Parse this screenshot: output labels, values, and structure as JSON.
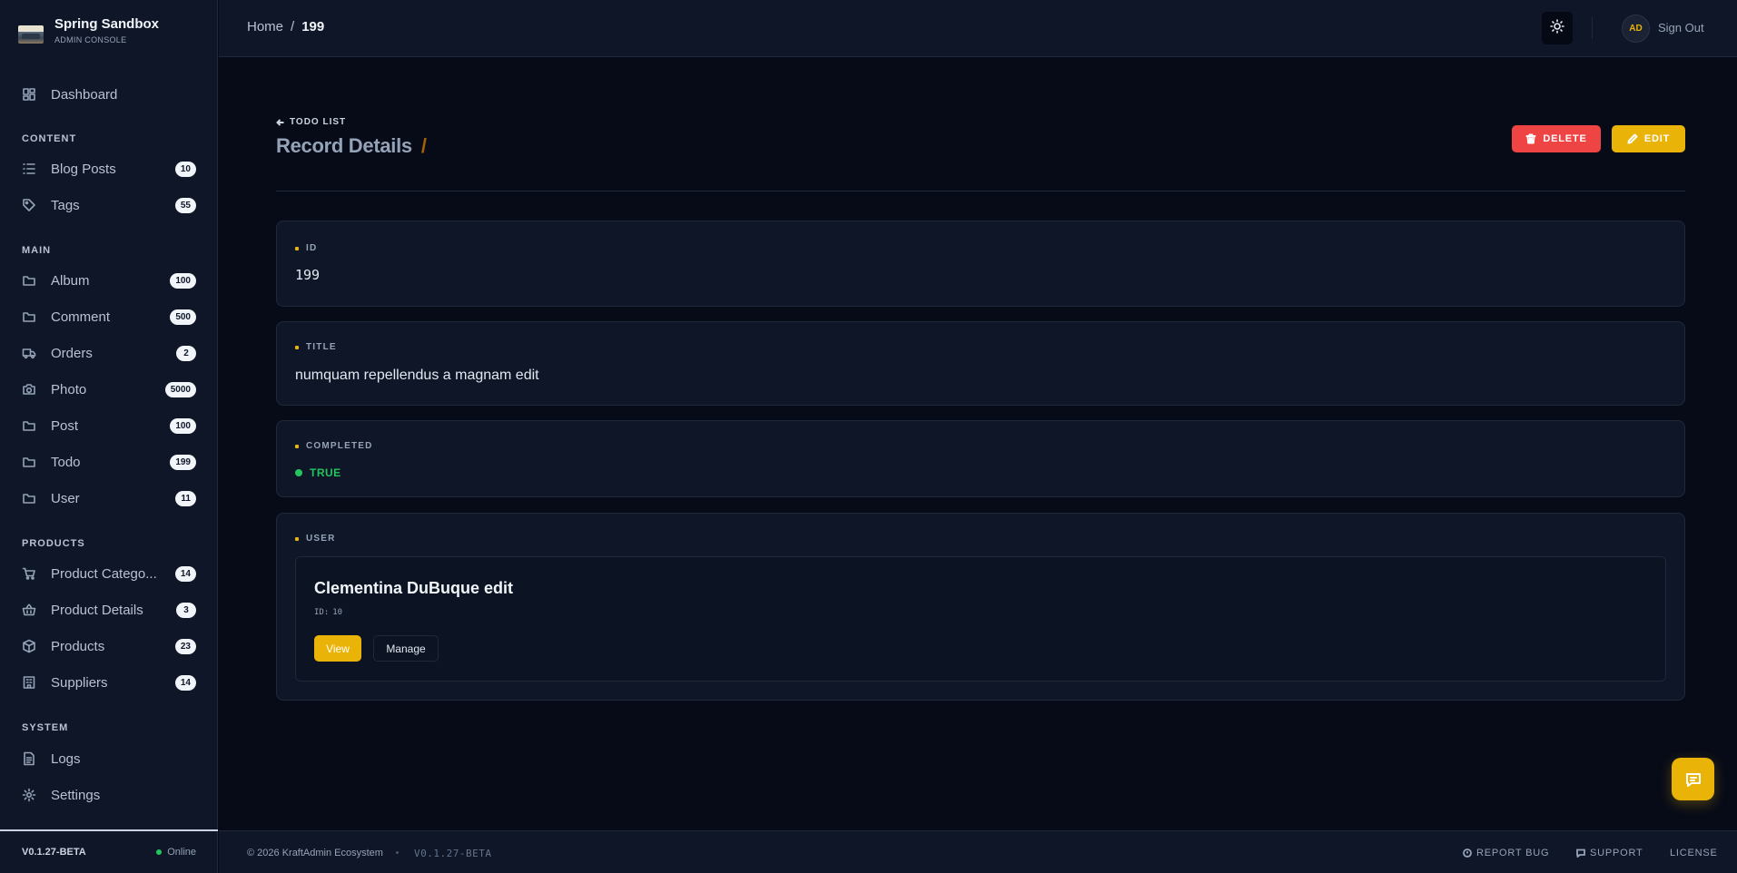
{
  "brand": {
    "title": "Spring Sandbox",
    "subtitle": "ADMIN CONSOLE"
  },
  "sidebar": {
    "dashboard": {
      "label": "Dashboard",
      "icon": "dashboard-icon"
    },
    "sections": {
      "content": "CONTENT",
      "main": "MAIN",
      "products": "PRODUCTS",
      "system": "SYSTEM"
    },
    "content_items": [
      {
        "label": "Blog Posts",
        "count": "10",
        "icon": "list-icon"
      },
      {
        "label": "Tags",
        "count": "55",
        "icon": "tag-icon"
      }
    ],
    "main_items": [
      {
        "label": "Album",
        "count": "100",
        "icon": "folder-icon"
      },
      {
        "label": "Comment",
        "count": "500",
        "icon": "folder-icon"
      },
      {
        "label": "Orders",
        "count": "2",
        "icon": "truck-icon"
      },
      {
        "label": "Photo",
        "count": "5000",
        "icon": "camera-icon"
      },
      {
        "label": "Post",
        "count": "100",
        "icon": "folder-icon"
      },
      {
        "label": "Todo",
        "count": "199",
        "icon": "folder-icon"
      },
      {
        "label": "User",
        "count": "11",
        "icon": "folder-icon"
      }
    ],
    "product_items": [
      {
        "label": "Product Catego...",
        "count": "14",
        "icon": "cart-icon"
      },
      {
        "label": "Product Details",
        "count": "3",
        "icon": "basket-icon"
      },
      {
        "label": "Products",
        "count": "23",
        "icon": "box-icon"
      },
      {
        "label": "Suppliers",
        "count": "14",
        "icon": "building-icon"
      }
    ],
    "system_items": [
      {
        "label": "Logs",
        "icon": "file-icon"
      },
      {
        "label": "Settings",
        "icon": "gear-icon"
      }
    ],
    "footer": {
      "version": "V0.1.27-BETA",
      "status": "Online"
    }
  },
  "topbar": {
    "breadcrumb": {
      "home": "Home",
      "separator": "/",
      "current": "199"
    },
    "avatar_initials": "AD",
    "sign_out": "Sign Out"
  },
  "page": {
    "back_label": "TODO LIST",
    "title": "Record Details",
    "title_suffix": "/",
    "delete_label": "DELETE",
    "edit_label": "EDIT"
  },
  "fields": {
    "id": {
      "label": "ID",
      "value": "199"
    },
    "title": {
      "label": "TITLE",
      "value": "numquam repellendus a magnam edit"
    },
    "completed": {
      "label": "COMPLETED",
      "value": "TRUE"
    },
    "user": {
      "label": "USER",
      "name": "Clementina DuBuque edit",
      "id_prefix": "ID:",
      "id_value": "10",
      "view_label": "View",
      "manage_label": "Manage"
    }
  },
  "footer": {
    "copyright": "© 2026 KraftAdmin Ecosystem",
    "version": "V0.1.27-BETA",
    "report_bug": "REPORT BUG",
    "support": "SUPPORT",
    "license": "LICENSE"
  },
  "colors": {
    "accent": "#eab308",
    "danger": "#ef4444",
    "success": "#22c55e",
    "background": "#070b17",
    "panel": "#0f1627"
  }
}
